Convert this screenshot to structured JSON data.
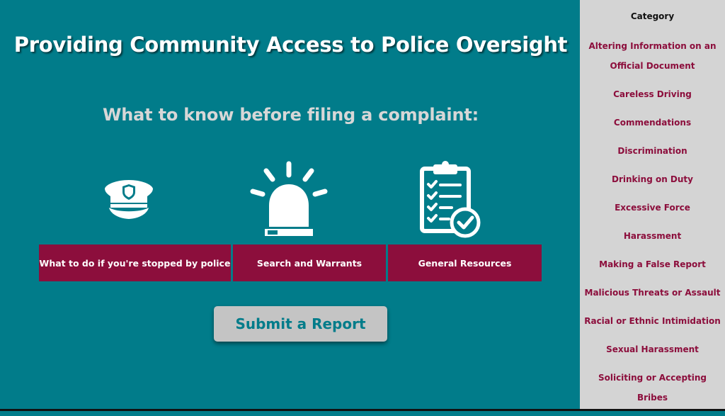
{
  "header": {
    "title": "Providing Community Access to Police Oversight",
    "subtitle": "What to know before filing a complaint:"
  },
  "cards": [
    {
      "label": "What to do if you're stopped by police",
      "icon": "police-cap-icon"
    },
    {
      "label": "Search and Warrants",
      "icon": "siren-icon"
    },
    {
      "label": "General Resources",
      "icon": "clipboard-checklist-icon"
    }
  ],
  "submit": {
    "label": "Submit a Report"
  },
  "sidebar": {
    "heading": "Category",
    "items": [
      "Altering Information on an Official Document",
      "Careless Driving",
      "Commendations",
      "Discrimination",
      "Drinking on Duty",
      "Excessive Force",
      "Harassment",
      "Making a False Report",
      "Malicious Threats or Assault",
      "Racial or Ethnic Intimidation",
      "Sexual Harassment",
      "Soliciting or Accepting Bribes"
    ]
  },
  "colors": {
    "background": "#017c8a",
    "accent": "#8c0e3c",
    "sidebar_bg": "#d4d4d4",
    "button_bg": "#c4c4c4"
  }
}
